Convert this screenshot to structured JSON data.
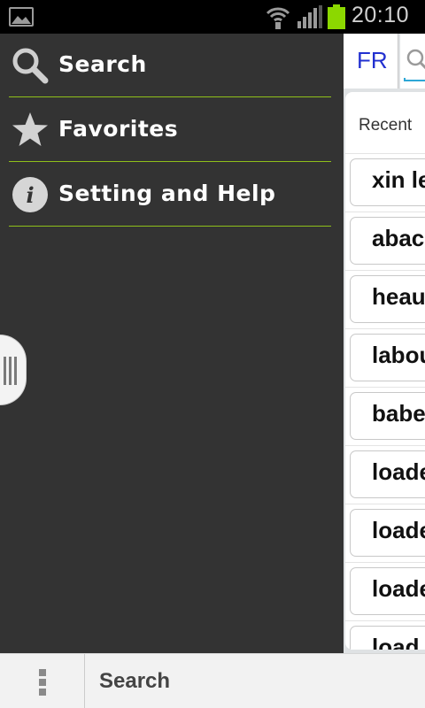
{
  "status_bar": {
    "time": "20:10",
    "icons": [
      "gallery-icon",
      "wifi-icon",
      "signal-icon",
      "battery-icon"
    ],
    "battery_color": "#8cd800"
  },
  "drawer": {
    "items": [
      {
        "label": "Search",
        "icon": "search-icon"
      },
      {
        "label": "Favorites",
        "icon": "star-icon"
      },
      {
        "label": "Setting and Help",
        "icon": "info-icon"
      }
    ],
    "divider_color": "#8fbf1a"
  },
  "main": {
    "language_tab": "FR",
    "recent_label": "Recent",
    "recent_items": [
      "xin le",
      "abac",
      "heau",
      "labou",
      "babe",
      "loade",
      "loade",
      "loade",
      "load"
    ]
  },
  "bottom_bar": {
    "title": "Search",
    "menu_icon": "overflow-menu-icon"
  }
}
